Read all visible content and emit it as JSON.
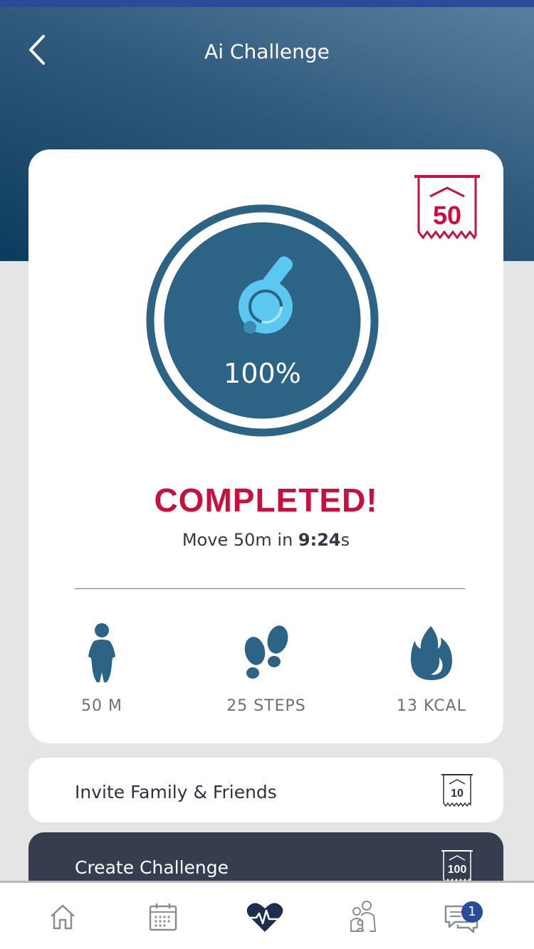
{
  "header": {
    "title": "Ai Challenge",
    "back_icon": "chevron-left-icon"
  },
  "challenge": {
    "reward_points": "50",
    "progress_percent": 100,
    "progress_label": "100%",
    "status": "COMPLETED!",
    "desc_prefix": "Move 50m in ",
    "desc_time": "9:24",
    "desc_suffix": "s",
    "icon": "whistle-icon"
  },
  "stats": [
    {
      "icon": "person-icon",
      "label": "50 M"
    },
    {
      "icon": "footprints-icon",
      "label": "25 STEPS"
    },
    {
      "icon": "flame-icon",
      "label": "13 KCAL"
    }
  ],
  "actions": {
    "invite": {
      "label": "Invite Family & Friends",
      "reward": "10"
    },
    "create": {
      "label": "Create Challenge",
      "reward": "100"
    }
  },
  "tabbar": {
    "tabs": [
      "home-icon",
      "calendar-icon",
      "heartbeat-icon",
      "family-icon",
      "chat-icon"
    ],
    "active_index": 2,
    "chat_badge": "1"
  },
  "colors": {
    "accent": "#c8103f",
    "primary": "#2d6485",
    "whistle": "#5bc8f0",
    "dark": "#363d4f",
    "badge": "#2a4a9a"
  }
}
